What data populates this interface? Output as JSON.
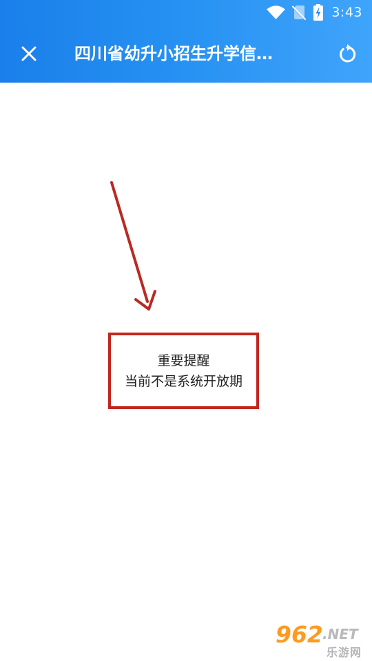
{
  "status_bar": {
    "time": "3:43",
    "icons": [
      "wifi-icon",
      "no-sim-icon",
      "battery-charging-icon"
    ]
  },
  "app_bar": {
    "title": "四川省幼升小招生升学信…",
    "close_icon": "close-icon",
    "refresh_icon": "refresh-icon"
  },
  "notice": {
    "title": "重要提醒",
    "message": "当前不是系统开放期"
  },
  "annotation": {
    "arrow_icon": "arrow-pointer-icon",
    "highlight_color": "#c3261f"
  },
  "watermark": {
    "main": "962",
    "suffix": ".NET",
    "sub": "乐游网"
  },
  "colors": {
    "header_start": "#1a7fea",
    "header_end": "#3fa4fb",
    "background": "#ffffff"
  }
}
